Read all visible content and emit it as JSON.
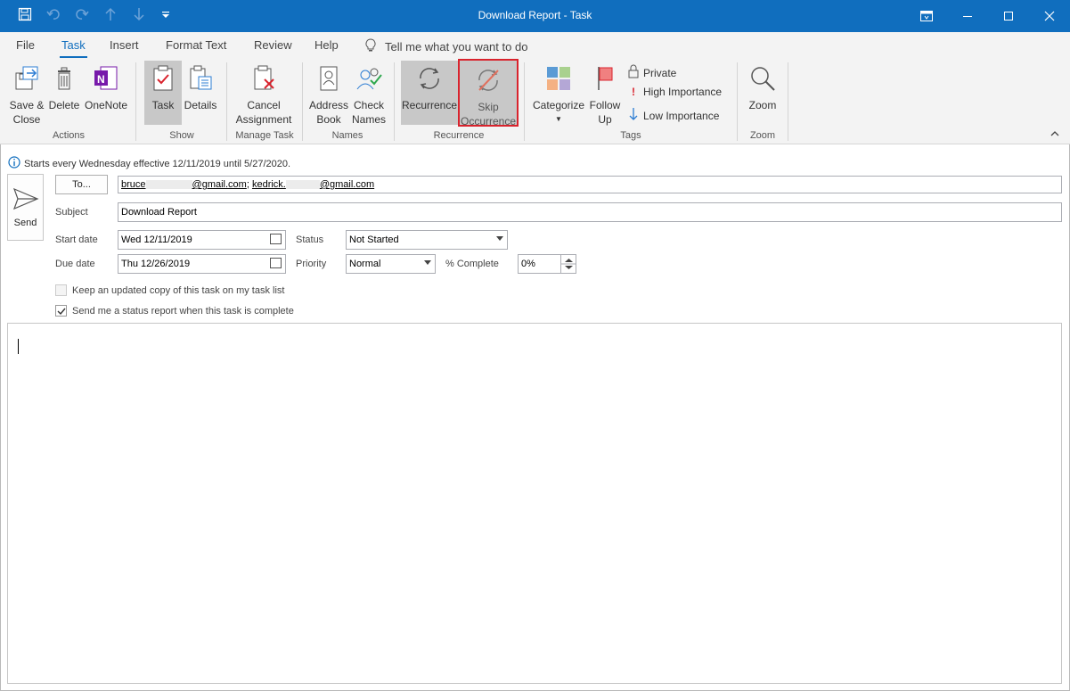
{
  "window": {
    "title": "Download Report  -  Task"
  },
  "menu": {
    "tabs": [
      "File",
      "Task",
      "Insert",
      "Format Text",
      "Review",
      "Help"
    ],
    "active_tab": "Task",
    "tell_me": "Tell me what you want to do"
  },
  "ribbon": {
    "actions": {
      "save_close": "Save &\nClose",
      "delete": "Delete",
      "onenote": "OneNote",
      "label": "Actions"
    },
    "show": {
      "task": "Task",
      "details": "Details",
      "label": "Show"
    },
    "manage": {
      "cancel": "Cancel\nAssignment",
      "label": "Manage Task"
    },
    "names": {
      "address_book": "Address\nBook",
      "check_names": "Check\nNames",
      "label": "Names"
    },
    "recurrence": {
      "recurrence": "Recurrence",
      "skip": "Skip\nOccurrence",
      "label": "Recurrence"
    },
    "tags": {
      "categorize": "Categorize",
      "follow_up": "Follow\nUp",
      "private": "Private",
      "high": "High Importance",
      "low": "Low Importance",
      "label": "Tags"
    },
    "zoom": {
      "zoom": "Zoom",
      "label": "Zoom"
    },
    "highlight_color": "#d9232d"
  },
  "form": {
    "info": "Starts every Wednesday effective 12/11/2019 until 5/27/2020.",
    "send": "Send",
    "to_button": "To...",
    "recipient1_a": "bruce",
    "recipient1_b": "@gmail.com",
    "sep": ";",
    "recipient2_a": "kedrick.",
    "recipient2_b": "@gmail.com",
    "subject_label": "Subject",
    "subject": "Download Report",
    "start_label": "Start date",
    "start": "Wed 12/11/2019",
    "due_label": "Due date",
    "due": "Thu 12/26/2019",
    "status_label": "Status",
    "status": "Not Started",
    "priority_label": "Priority",
    "priority": "Normal",
    "complete_label": "% Complete",
    "complete": "0%",
    "keep_copy": "Keep an updated copy of this task on my task list",
    "send_report": "Send me a status report when this task is complete"
  }
}
